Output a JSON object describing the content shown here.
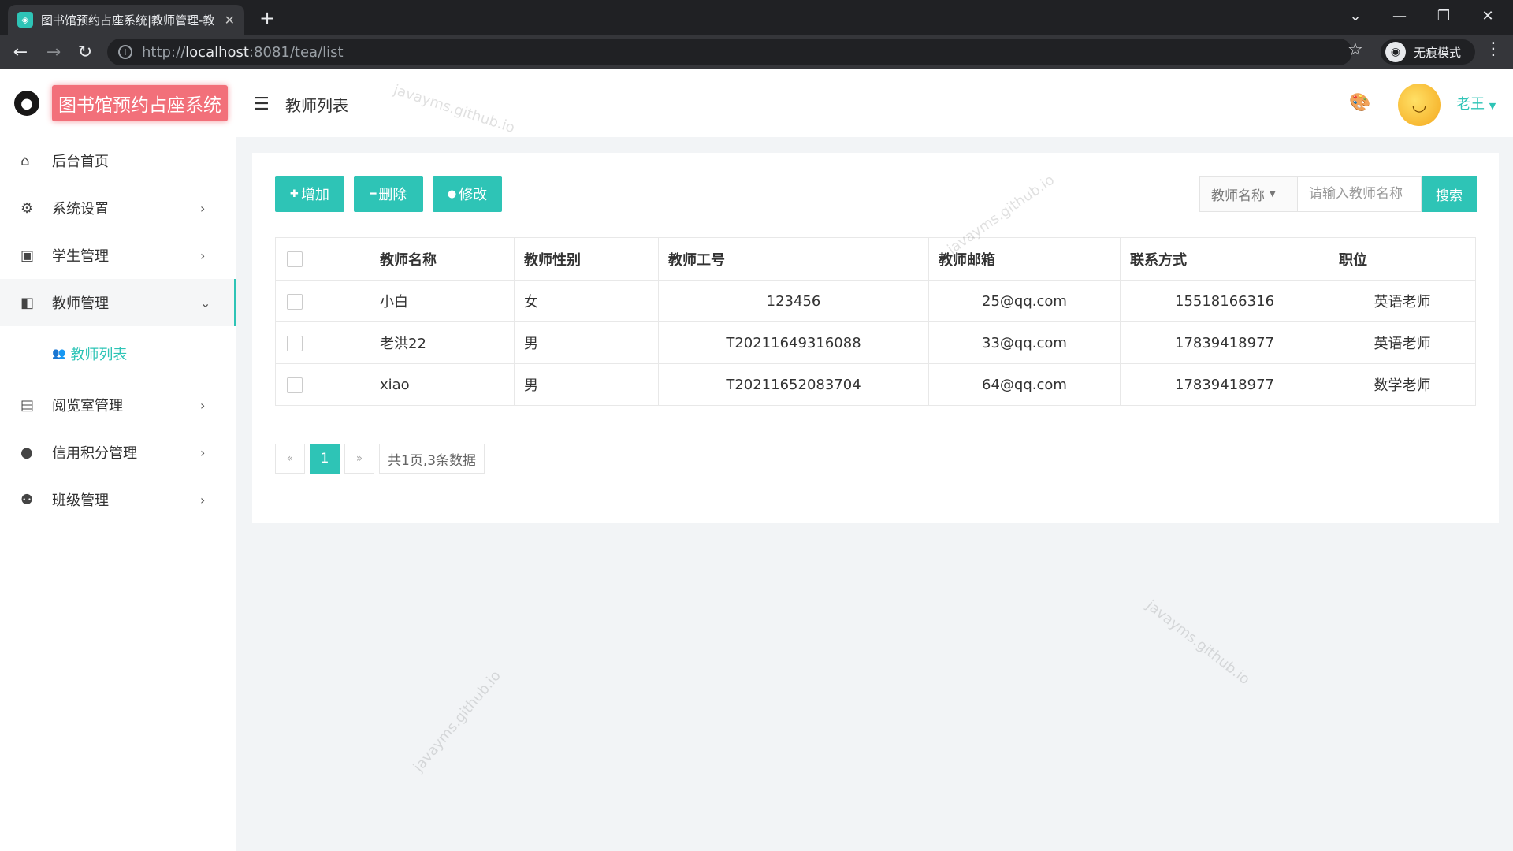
{
  "browser": {
    "tab_title": "图书馆预约占座系统|教师管理-教",
    "url_scheme": "http://",
    "url_host": "localhost",
    "url_rest": ":8081/tea/list",
    "incognito_label": "无痕模式"
  },
  "app": {
    "brand": "图书馆预约占座系统",
    "page_title": "教师列表",
    "username": "老王",
    "accent_color": "#2ec4b6"
  },
  "sidebar": {
    "items": [
      {
        "label": "后台首页",
        "icon": "home-icon"
      },
      {
        "label": "系统设置",
        "icon": "gear-icon"
      },
      {
        "label": "学生管理",
        "icon": "student-badge-icon"
      },
      {
        "label": "教师管理",
        "icon": "teacher-icon"
      },
      {
        "label": "阅览室管理",
        "icon": "book-icon"
      },
      {
        "label": "信用积分管理",
        "icon": "user-icon"
      },
      {
        "label": "班级管理",
        "icon": "group-icon"
      }
    ],
    "sub_item": "教师列表"
  },
  "toolbar": {
    "add_label": "增加",
    "delete_label": "删除",
    "edit_label": "修改"
  },
  "search": {
    "field_label": "教师名称",
    "placeholder": "请输入教师名称",
    "button_label": "搜索"
  },
  "table": {
    "headers": [
      "教师名称",
      "教师性别",
      "教师工号",
      "教师邮箱",
      "联系方式",
      "职位"
    ],
    "rows": [
      {
        "name": "小白",
        "gender": "女",
        "id": "123456",
        "email": "25@qq.com",
        "phone": "15518166316",
        "position": "英语老师"
      },
      {
        "name": "老洪22",
        "gender": "男",
        "id": "T20211649316088",
        "email": "33@qq.com",
        "phone": "17839418977",
        "position": "英语老师"
      },
      {
        "name": "xiao",
        "gender": "男",
        "id": "T20211652083704",
        "email": "64@qq.com",
        "phone": "17839418977",
        "position": "数学老师"
      }
    ]
  },
  "pagination": {
    "prev": "«",
    "current": "1",
    "next": "»",
    "summary": "共1页,3条数据"
  },
  "watermark": "javayms.github.io"
}
